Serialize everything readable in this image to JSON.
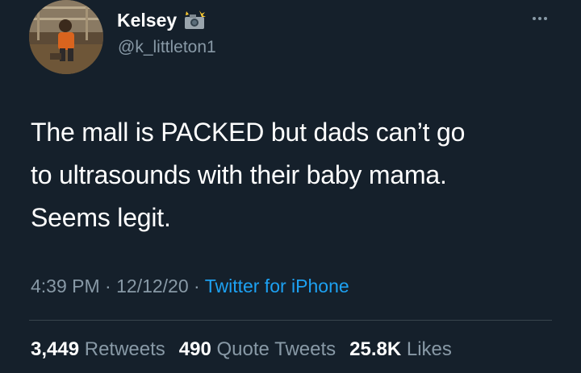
{
  "user": {
    "display_name": "Kelsey",
    "handle": "@k_littleton1",
    "badge_icon": "camera-with-flash-emoji"
  },
  "tweet": {
    "lines": [
      "The mall is PACKED but dads can’t go",
      "to ultrasounds with their baby mama.",
      "Seems legit."
    ],
    "time": "4:39 PM",
    "separator": "·",
    "date": "12/12/20",
    "source": "Twitter for iPhone"
  },
  "stats": {
    "retweets_count": "3,449",
    "retweets_label": "Retweets",
    "quotes_count": "490",
    "quotes_label": "Quote Tweets",
    "likes_count": "25.8K",
    "likes_label": "Likes"
  },
  "colors": {
    "background": "#15202b",
    "text_primary": "#ffffff",
    "text_secondary": "#8899a6",
    "accent": "#1da1f2",
    "divider": "#38444d"
  },
  "icons": {
    "more": "more-horizontal-icon"
  }
}
